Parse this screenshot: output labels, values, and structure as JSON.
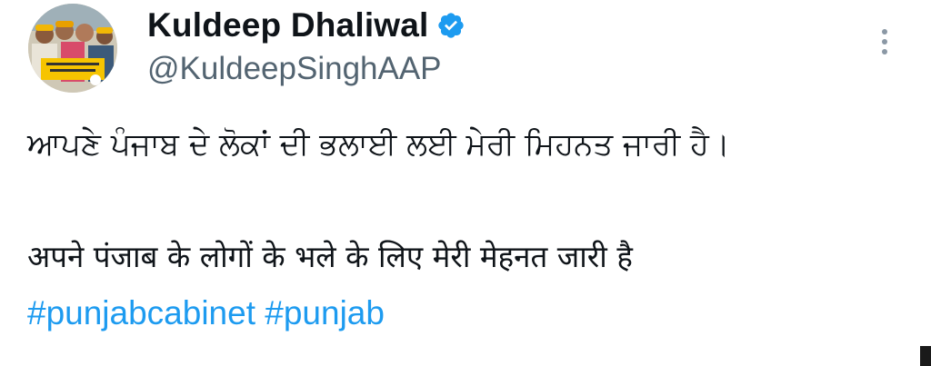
{
  "author": {
    "display_name": "Kuldeep Dhaliwal",
    "handle": "@KuldeepSinghAAP",
    "verified_icon": "verified-badge-icon",
    "avatar_icon": "profile-photo"
  },
  "tweet": {
    "line_gurmukhi": "ਆਪਣੇ ਪੰਜਾਬ ਦੇ ਲੋਕਾਂ ਦੀ ਭਲਾਈ ਲਈ ਮੇਰੀ ਮਿਹਨਤ ਜਾਰੀ ਹੈ।",
    "line_hindi": "अपने पंजाब के लोगों के भले के लिए मेरी मेहनत जारी है",
    "hashtags": [
      "#punjabcabinet",
      "#punjab"
    ]
  },
  "menu": {
    "more_icon": "more-options-icon"
  },
  "colors": {
    "text": "#0f1419",
    "secondary": "#536471",
    "link": "#1d9bf0",
    "verified": "#1d9bf0"
  }
}
